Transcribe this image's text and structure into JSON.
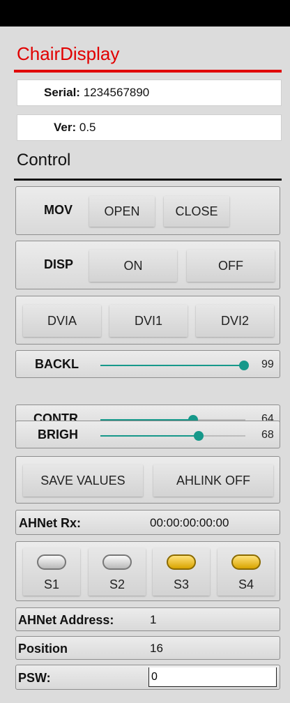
{
  "app": {
    "title": "ChairDisplay"
  },
  "info": {
    "serial_label": "Serial:",
    "serial_value": "1234567890",
    "ver_label": "Ver:",
    "ver_value": "0.5"
  },
  "control": {
    "title": "Control"
  },
  "mov": {
    "label": "MOV",
    "open": "OPEN",
    "close": "CLOSE"
  },
  "disp": {
    "label": "DISP",
    "on": "ON",
    "off": "OFF"
  },
  "inputs": {
    "a": "DVIA",
    "b": "DVI1",
    "c": "DVI2"
  },
  "sliders": {
    "backl": {
      "label": "BACKL",
      "value": "99",
      "fraction": 0.99
    },
    "contr": {
      "label": "CONTR",
      "value": "64",
      "fraction": 0.64
    },
    "brigh": {
      "label": "BRIGH",
      "value": "68",
      "fraction": 0.68
    }
  },
  "actions": {
    "save": "SAVE VALUES",
    "ahlink": "AHLINK OFF"
  },
  "ahnet": {
    "label": "AHNet Rx:",
    "value": "00:00:00:00:00"
  },
  "switches": [
    {
      "label": "S1",
      "state": "off"
    },
    {
      "label": "S2",
      "state": "off"
    },
    {
      "label": "S3",
      "state": "on"
    },
    {
      "label": "S4",
      "state": "on"
    }
  ],
  "address": {
    "label": "AHNet Address:",
    "value": "1"
  },
  "position": {
    "label": "Position",
    "value": "16"
  },
  "psw": {
    "label": "PSW:",
    "value": "0"
  },
  "colors": {
    "accent": "#e10000",
    "slider": "#16988a",
    "led_on": "#f2c200"
  }
}
